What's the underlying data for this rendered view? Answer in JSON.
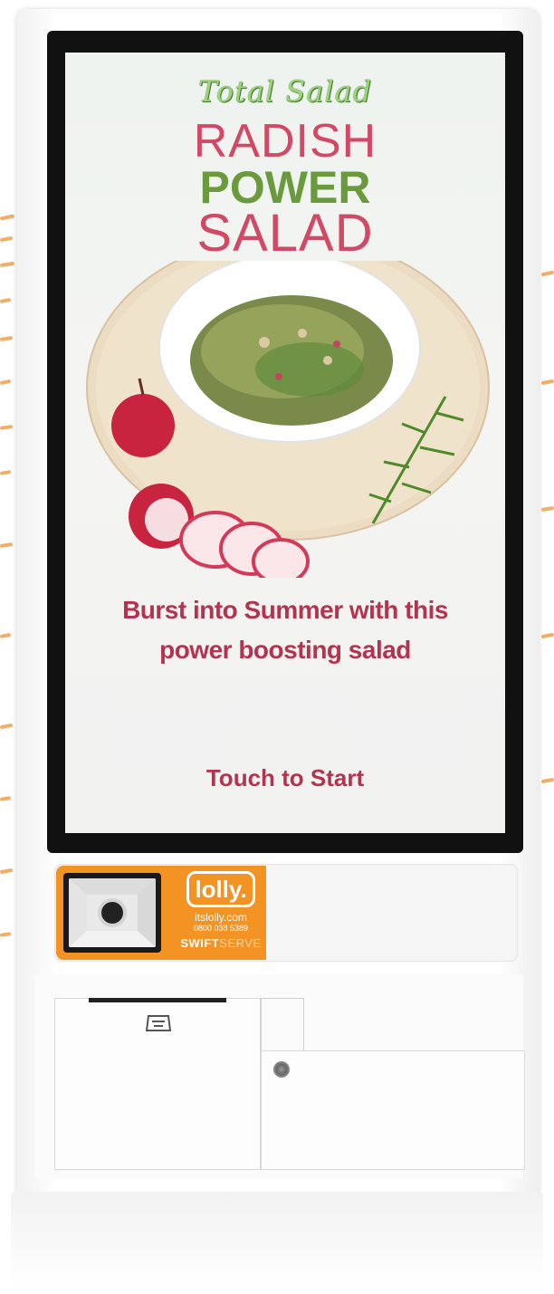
{
  "screen": {
    "script_title": "Total Salad",
    "title_line1": "RADISH",
    "title_line2": "POWER",
    "title_line3": "SALAD",
    "tagline_line1": "Burst into Summer with this",
    "tagline_line2": "power boosting salad",
    "touch_prompt": "Touch to Start"
  },
  "brand": {
    "logo": "lolly.",
    "website": "itslolly.com",
    "phone": "0800 038 5389",
    "product_bold": "SWIFT",
    "product_light": "SERVE"
  },
  "icons": {
    "scanner": "barcode-scanner-icon",
    "printer": "receipt-printer-icon",
    "lock": "lock-icon"
  },
  "colors": {
    "title_pink": "#d04a66",
    "title_green": "#6a9a3c",
    "script_green": "#9dd37a",
    "text_red": "#b3344f",
    "brand_orange": "#f29324"
  }
}
